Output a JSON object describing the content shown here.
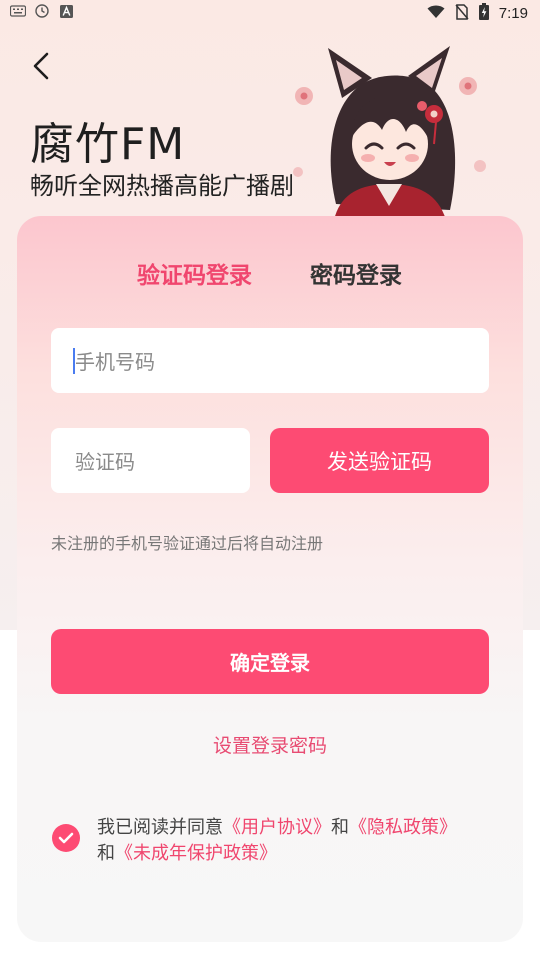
{
  "status_bar": {
    "time": "7:19",
    "left_icons": [
      "keyboard-icon",
      "clock-icon",
      "a-icon"
    ],
    "right_icons": [
      "wifi-icon",
      "no-sim-icon",
      "battery-charging-icon"
    ]
  },
  "header": {
    "title": "腐竹FM",
    "subtitle": "畅听全网热播高能广播剧"
  },
  "tabs": [
    {
      "label": "验证码登录",
      "active": true
    },
    {
      "label": "密码登录",
      "active": false
    }
  ],
  "form": {
    "phone_placeholder": "手机号码",
    "code_placeholder": "验证码",
    "send_code_label": "发送验证码",
    "hint": "未注册的手机号验证通过后将自动注册",
    "login_label": "确定登录",
    "set_password_label": "设置登录密码"
  },
  "agreement": {
    "prefix": "我已阅读并同意",
    "user_agreement": "《用户协议》",
    "and1": "和",
    "privacy_policy": "《隐私政策》",
    "and2": "和",
    "minor_policy": "《未成年保护政策》",
    "checked": true
  },
  "colors": {
    "accent": "#fd4b73",
    "accent_text": "#f0466e"
  }
}
